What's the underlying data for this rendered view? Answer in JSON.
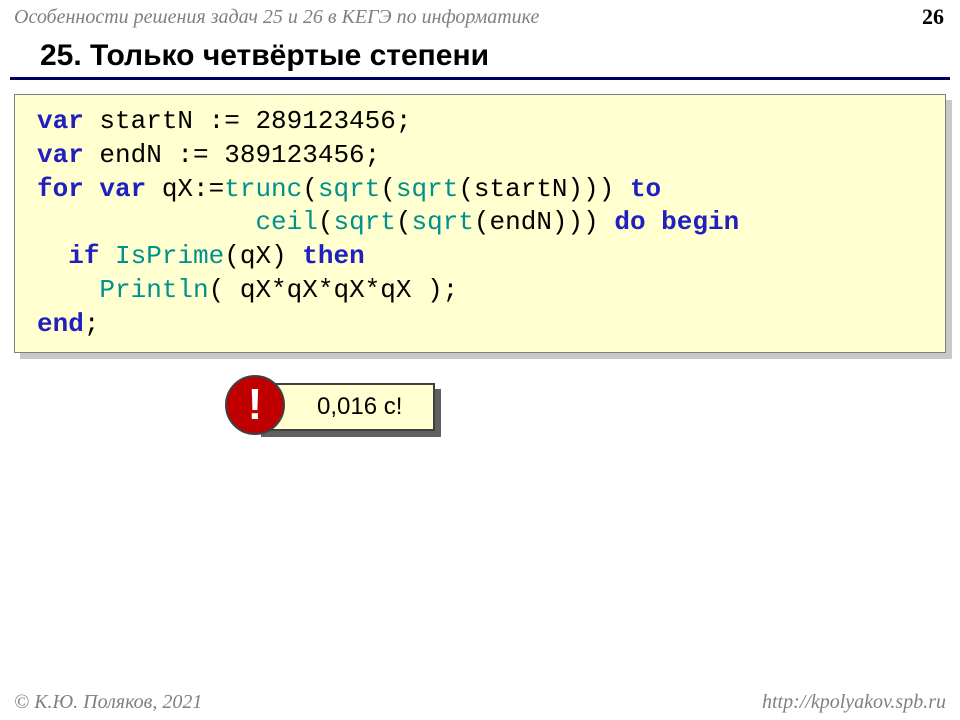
{
  "header": {
    "subtitle": "Особенности решения задач 25 и 26 в КЕГЭ по информатике",
    "page_number": "26"
  },
  "title": "25. Только четвёртые степени",
  "code": {
    "lines": [
      [
        {
          "cls": "kw",
          "t": "var"
        },
        {
          "cls": "txt",
          "t": " startN := 289123456;"
        }
      ],
      [
        {
          "cls": "kw",
          "t": "var"
        },
        {
          "cls": "txt",
          "t": " endN := 389123456;"
        }
      ],
      [
        {
          "cls": "kw",
          "t": "for var"
        },
        {
          "cls": "txt",
          "t": " qX:="
        },
        {
          "cls": "fn",
          "t": "trunc"
        },
        {
          "cls": "txt",
          "t": "("
        },
        {
          "cls": "fn",
          "t": "sqrt"
        },
        {
          "cls": "txt",
          "t": "("
        },
        {
          "cls": "fn",
          "t": "sqrt"
        },
        {
          "cls": "txt",
          "t": "(startN))) "
        },
        {
          "cls": "kw",
          "t": "to"
        }
      ],
      [
        {
          "cls": "txt",
          "t": "              "
        },
        {
          "cls": "fn",
          "t": "ceil"
        },
        {
          "cls": "txt",
          "t": "("
        },
        {
          "cls": "fn",
          "t": "sqrt"
        },
        {
          "cls": "txt",
          "t": "("
        },
        {
          "cls": "fn",
          "t": "sqrt"
        },
        {
          "cls": "txt",
          "t": "(endN))) "
        },
        {
          "cls": "kw",
          "t": "do begin"
        }
      ],
      [
        {
          "cls": "txt",
          "t": "  "
        },
        {
          "cls": "kw",
          "t": "if"
        },
        {
          "cls": "txt",
          "t": " "
        },
        {
          "cls": "fn",
          "t": "IsPrime"
        },
        {
          "cls": "txt",
          "t": "(qX) "
        },
        {
          "cls": "kw",
          "t": "then"
        }
      ],
      [
        {
          "cls": "txt",
          "t": "    "
        },
        {
          "cls": "fn",
          "t": "Println"
        },
        {
          "cls": "txt",
          "t": "( qX*qX*qX*qX );"
        }
      ],
      [
        {
          "cls": "kw",
          "t": "end"
        },
        {
          "cls": "txt",
          "t": ";"
        }
      ]
    ]
  },
  "badge": {
    "mark": "!",
    "text": "0,016 с!"
  },
  "footer": {
    "left": "© К.Ю. Поляков, 2021",
    "right": "http://kpolyakov.spb.ru"
  }
}
